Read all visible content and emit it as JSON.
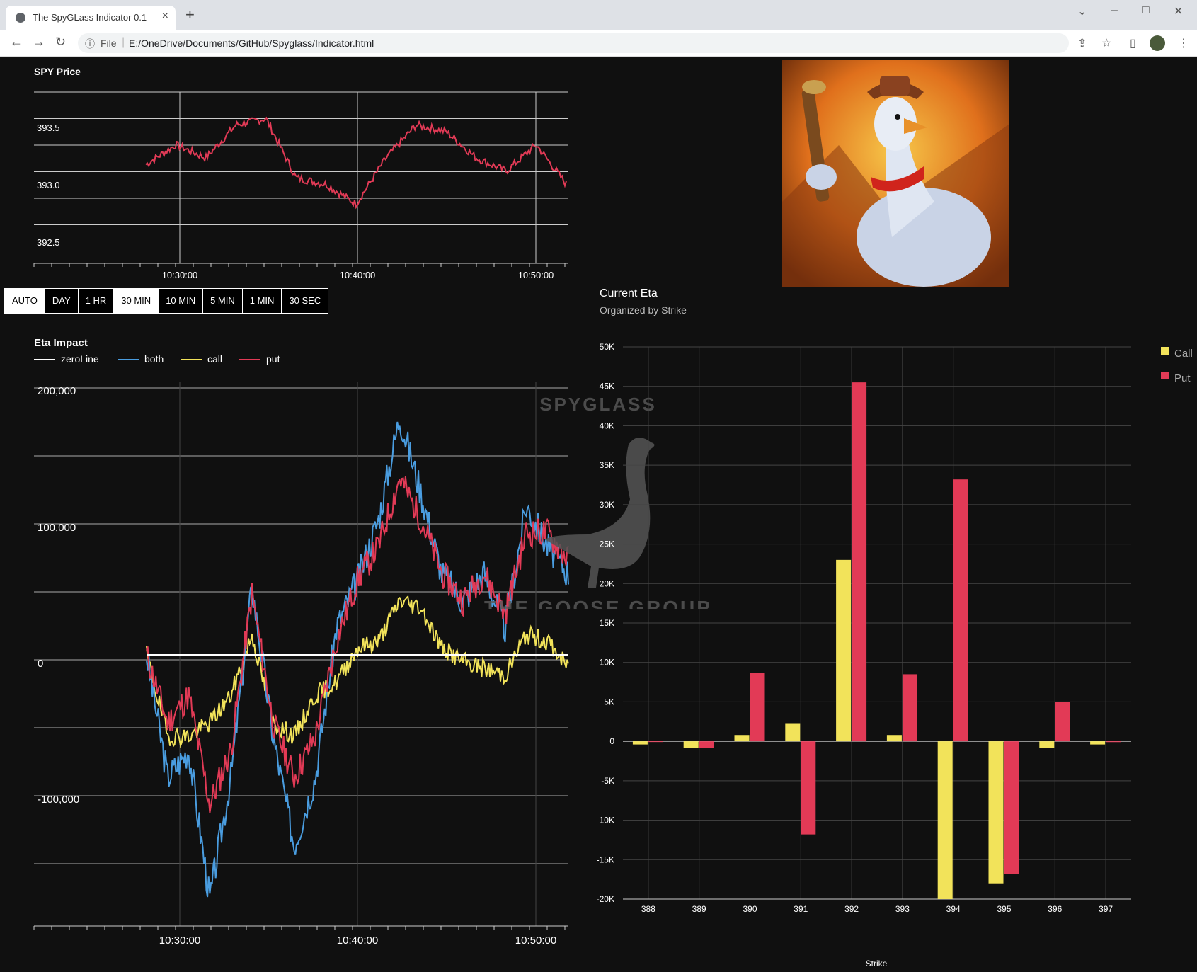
{
  "browser": {
    "tab_title": "The SpyGLass Indicator 0.1",
    "url_scheme": "File",
    "url": "E:/OneDrive/Documents/GitHub/Spyglass/Indicator.html"
  },
  "spy_price": {
    "title": "SPY Price",
    "y_ticks": [
      "393.5",
      "393.0",
      "392.5"
    ],
    "x_ticks": [
      "10:30:00",
      "10:40:00",
      "10:50:00"
    ]
  },
  "timeframes": {
    "buttons": [
      "AUTO",
      "DAY",
      "1 HR",
      "30 MIN",
      "10 MIN",
      "5 MIN",
      "1 MIN",
      "30 SEC"
    ],
    "selected": [
      "AUTO",
      "30 MIN"
    ]
  },
  "eta_impact": {
    "title": "Eta Impact",
    "legend": [
      {
        "name": "zeroLine",
        "color": "#ffffff"
      },
      {
        "name": "both",
        "color": "#4a9de0"
      },
      {
        "name": "call",
        "color": "#f2e35a"
      },
      {
        "name": "put",
        "color": "#e23a56"
      }
    ],
    "y_ticks": [
      "200,000",
      "100,000",
      "0",
      "-100,000"
    ],
    "x_ticks": [
      "10:30:00",
      "10:40:00",
      "10:50:00"
    ]
  },
  "current_eta": {
    "title": "Current Eta",
    "subtitle": "Organized by Strike",
    "xlabel": "Strike",
    "y_ticks": [
      "50K",
      "45K",
      "40K",
      "35K",
      "30K",
      "25K",
      "20K",
      "15K",
      "10K",
      "5K",
      "0",
      "-5K",
      "-10K",
      "-15K",
      "-20K"
    ],
    "legend": [
      {
        "name": "Call",
        "color": "#f2e35a"
      },
      {
        "name": "Put",
        "color": "#e23a56"
      }
    ]
  },
  "watermark": {
    "top": "SPYGLASS",
    "bottom": "THE GOOSE GROUP"
  },
  "chart_data": [
    {
      "type": "line",
      "title": "SPY Price",
      "x": [
        "10:30:00",
        "10:40:00",
        "10:50:00"
      ],
      "ylim": [
        392.5,
        393.8
      ],
      "series": [
        {
          "values": [
            393.25,
            393.4,
            393.3,
            393.55,
            393.6,
            393.15,
            393.1,
            392.95,
            393.3,
            393.55,
            393.5,
            393.3,
            393.2,
            393.4,
            393.1
          ]
        }
      ]
    },
    {
      "type": "bar",
      "title": "Current Eta",
      "xlabel": "Strike",
      "ylim": [
        -20000,
        50000
      ],
      "categories": [
        "388",
        "389",
        "390",
        "391",
        "392",
        "393",
        "394",
        "395",
        "396",
        "397"
      ],
      "series": [
        {
          "name": "Call",
          "values": [
            -400,
            -800,
            800,
            2300,
            23000,
            800,
            -20000,
            -18000,
            -800,
            -400
          ]
        },
        {
          "name": "Put",
          "values": [
            0,
            -800,
            8700,
            -11800,
            45500,
            8500,
            33200,
            -16800,
            5000,
            -100
          ]
        }
      ]
    }
  ]
}
